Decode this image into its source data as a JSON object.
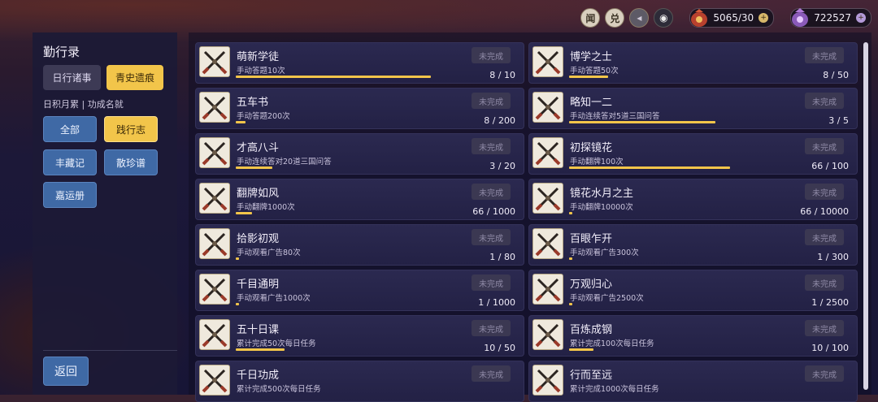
{
  "hud": {
    "icons": [
      {
        "name": "hear-icon",
        "glyph": "闻"
      },
      {
        "name": "exchange-icon",
        "glyph": "兑"
      },
      {
        "name": "sound-icon",
        "glyph": "◂"
      },
      {
        "name": "eye-icon",
        "glyph": "◉"
      }
    ],
    "resource_1": {
      "value": "5065/30",
      "icon": "money-bag-icon",
      "plus": "+"
    },
    "resource_2": {
      "value": "722527",
      "icon": "purple-bag-icon",
      "plus": "+"
    }
  },
  "sidebar": {
    "title": "勤行录",
    "tabs": [
      {
        "label": "日行诸事",
        "active": false
      },
      {
        "label": "青史遗痕",
        "active": true
      }
    ],
    "subtitle": "日积月累 | 功成名就",
    "categories": [
      {
        "label": "全部",
        "active": false
      },
      {
        "label": "践行志",
        "active": true
      },
      {
        "label": "丰藏记",
        "active": false
      },
      {
        "label": "散珍谱",
        "active": false
      },
      {
        "label": "嘉运册",
        "active": false
      }
    ],
    "back_label": "返回"
  },
  "achievements": [
    {
      "name": "萌新学徒",
      "desc": "手动答题10次",
      "status": "未完成",
      "progress": "8 / 10",
      "ratio": 0.8
    },
    {
      "name": "博学之士",
      "desc": "手动答题50次",
      "status": "未完成",
      "progress": "8 / 50",
      "ratio": 0.16
    },
    {
      "name": "五车书",
      "desc": "手动答题200次",
      "status": "未完成",
      "progress": "8 / 200",
      "ratio": 0.04
    },
    {
      "name": "略知一二",
      "desc": "手动连续答对5道三国问答",
      "status": "未完成",
      "progress": "3 / 5",
      "ratio": 0.6
    },
    {
      "name": "才高八斗",
      "desc": "手动连续答对20道三国问答",
      "status": "未完成",
      "progress": "3 / 20",
      "ratio": 0.15
    },
    {
      "name": "初探镜花",
      "desc": "手动翻牌100次",
      "status": "未完成",
      "progress": "66 / 100",
      "ratio": 0.66
    },
    {
      "name": "翻牌如风",
      "desc": "手动翻牌1000次",
      "status": "未完成",
      "progress": "66 / 1000",
      "ratio": 0.066
    },
    {
      "name": "镜花水月之主",
      "desc": "手动翻牌10000次",
      "status": "未完成",
      "progress": "66 / 10000",
      "ratio": 0.0066
    },
    {
      "name": "拾影初观",
      "desc": "手动观看广告80次",
      "status": "未完成",
      "progress": "1 / 80",
      "ratio": 0.0125
    },
    {
      "name": "百眼乍开",
      "desc": "手动观看广告300次",
      "status": "未完成",
      "progress": "1 / 300",
      "ratio": 0.0033
    },
    {
      "name": "千目通明",
      "desc": "手动观看广告1000次",
      "status": "未完成",
      "progress": "1 / 1000",
      "ratio": 0.001
    },
    {
      "name": "万观归心",
      "desc": "手动观看广告2500次",
      "status": "未完成",
      "progress": "1 / 2500",
      "ratio": 0.0004
    },
    {
      "name": "五十日课",
      "desc": "累计完成50次每日任务",
      "status": "未完成",
      "progress": "10 / 50",
      "ratio": 0.2
    },
    {
      "name": "百炼成钢",
      "desc": "累计完成100次每日任务",
      "status": "未完成",
      "progress": "10 / 100",
      "ratio": 0.1
    },
    {
      "name": "千日功成",
      "desc": "累计完成500次每日任务",
      "status": "未完成",
      "progress": "",
      "ratio": 0
    },
    {
      "name": "行而至远",
      "desc": "累计完成1000次每日任务",
      "status": "未完成",
      "progress": "",
      "ratio": 0
    }
  ],
  "colors": {
    "accent": "#f2c54a",
    "button_blue": "#3f69a5",
    "panel": "#1c1a36"
  }
}
